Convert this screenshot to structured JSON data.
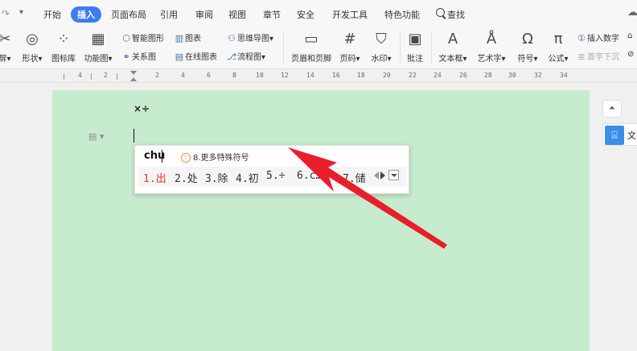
{
  "menubar": {
    "tabs": [
      "开始",
      "插入",
      "页面布局",
      "引用",
      "审阅",
      "视图",
      "章节",
      "安全",
      "开发工具",
      "特色功能"
    ],
    "active_tab": "插入",
    "search_label": "查找"
  },
  "ribbon": {
    "partial_left": "屏",
    "shape_label": "形状",
    "icon_library_label": "图标库",
    "function_chart_label": "功能图",
    "smart_shape_label": "智能图形",
    "chart_label": "图表",
    "mind_map_label": "思维导图",
    "relation_label": "关系图",
    "online_chart_label": "在线图表",
    "flowchart_label": "流程图",
    "header_footer_label": "页眉和页脚",
    "page_number_label": "页码",
    "watermark_label": "水印",
    "comment_label": "批注",
    "textbox_label": "文本框",
    "art_text_label": "艺术字",
    "symbol_label": "符号",
    "formula_label": "公式",
    "insert_number_label": "插入数字",
    "drop_cap_label": "首字下沉"
  },
  "ruler": {
    "marks": [
      "4",
      "2",
      "2",
      "4",
      "6",
      "8",
      "10",
      "12",
      "14",
      "16",
      "18",
      "20",
      "22",
      "24",
      "26",
      "28",
      "30",
      "32",
      "34"
    ]
  },
  "document": {
    "symbols_line": "×÷"
  },
  "ime": {
    "pinyin": "chu",
    "hint": "8.更多特殊符号",
    "candidates": [
      "1.出",
      "2.处",
      "3.除",
      "4.初",
      "5.÷",
      "6.c…",
      "7.储"
    ]
  },
  "side_panel": {
    "tab_label": "文"
  },
  "colors": {
    "page_background": "#c7ebcd",
    "active_tab": "#3c7ef0",
    "arrow": "#e81e2a",
    "first_candidate": "#ee3333"
  }
}
